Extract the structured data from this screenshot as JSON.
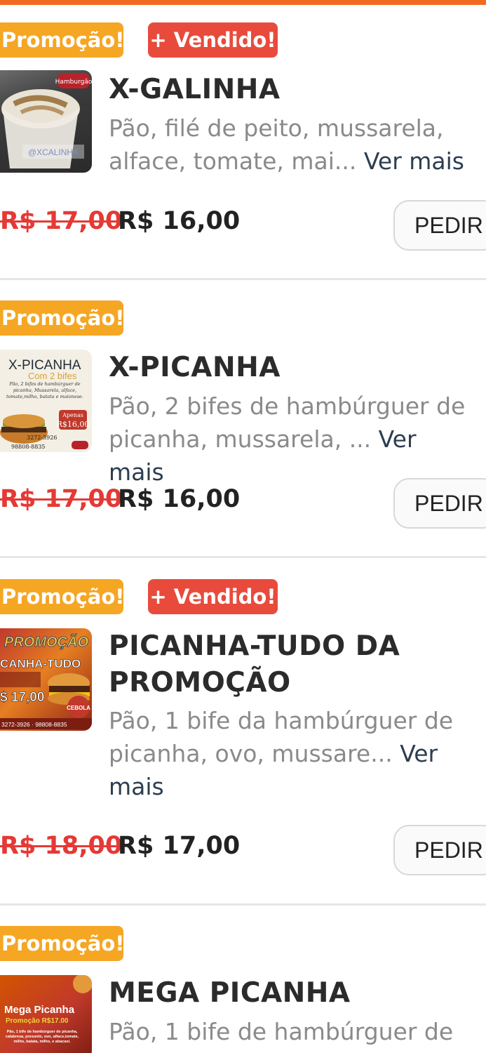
{
  "badges": {
    "promo": "Promoção!",
    "sold": "+ Vendido!"
  },
  "buttons": {
    "order": "PEDIR"
  },
  "items": [
    {
      "title": "X-GALINHA",
      "desc": "Pão, filé de peito, mussarela, alface, tomate, mai...",
      "more": "Ver mais",
      "old_price": "R$ 17,00",
      "new_price": "R$ 16,00",
      "thumb_text": [
        "Hamburgão",
        "@XCALINHA"
      ]
    },
    {
      "title": "X-PICANHA",
      "desc": "Pão, 2 bifes de hambúrguer de picanha, mussarela, ...",
      "more": "Ver mais",
      "old_price": "R$ 17,00",
      "new_price": "R$ 16,00",
      "thumb_text": [
        "X-PICANHA",
        "Com 2 bifes",
        "Pão, 2 bifes de hambúrguer de picanha, Mussarela, alface, tomate,milho, batata e maionese.",
        "Apenas",
        "R$16,00",
        "3272-3926",
        "98808-8835"
      ]
    },
    {
      "title_line1": "PICANHA-TUDO DA",
      "title_line2": "PROMOÇÃO",
      "desc_line1": "Pão, 1 bife da hambúrguer de",
      "desc_line2": "picanha, ovo, mussare...",
      "more_a": "Ver",
      "more_b": "mais",
      "old_price": "R$ 18,00",
      "new_price": "R$ 17,00",
      "thumb_text": [
        "PROMOÇÃO",
        "CANHA-TUDO",
        "$ 17,00",
        "CEBOLA",
        "3272-3926 · 98808-8835"
      ]
    },
    {
      "title": "MEGA PICANHA",
      "desc": "Pão, 1 bife de hambúrguer de",
      "thumb_text": [
        "Mega Picanha",
        "Promoção R$17.00",
        "Pão, 1 bife de hambúrguer de picanha, calabresa, presunto, ovo, alface,tomate, milho, batata, milho, e abacaxi."
      ]
    }
  ],
  "colors": {
    "accent": "#f26a21",
    "promo": "#f5a623",
    "sold": "#e84b3c",
    "old_price": "#e53935",
    "link": "#2c3e50"
  }
}
